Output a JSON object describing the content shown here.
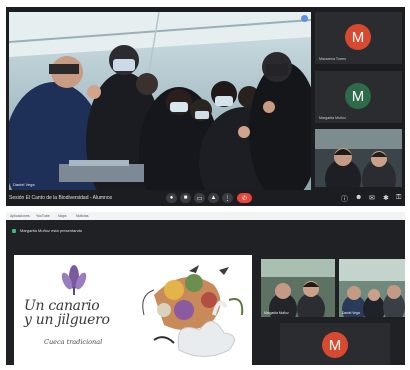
{
  "call_top": {
    "main_participant_label": "Daniel Vega",
    "meeting_title": "Sesión El Canto de la Biodiversidad - Alumnos",
    "participants": [
      {
        "name": "Macarena Torres",
        "initial": "M",
        "avatar_color": "#d84a2f"
      },
      {
        "name": "Margarita Muñoz",
        "initial": "M",
        "avatar_color": "#2e6b4a"
      }
    ],
    "controls": [
      "mic-icon",
      "camera-icon",
      "present-icon",
      "more-icon",
      "captions-icon",
      "end-call-icon"
    ],
    "right_icons": [
      "info-icon",
      "people-icon",
      "chat-icon",
      "activities-icon",
      "lock-icon"
    ]
  },
  "call_bottom": {
    "bookmarks": [
      "Aplicaciones",
      "YouTube",
      "Maps",
      "Noticias"
    ],
    "presenting_text": "Margarita Muñoz está presentando",
    "slide": {
      "title_line1": "Un canario",
      "title_line2": "y un jilguero",
      "subtitle": "Cueca tradicional"
    },
    "participants": [
      {
        "name": "Margarita Muñoz"
      },
      {
        "name": "Daniel Vega"
      },
      {
        "name": "Macarena Torres",
        "initial": "M",
        "avatar_color": "#d84a2f"
      }
    ]
  }
}
